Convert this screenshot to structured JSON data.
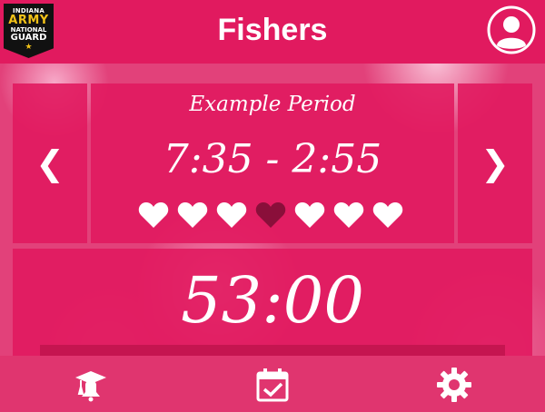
{
  "header": {
    "title": "Fishers",
    "badge": {
      "line1": "INDIANA",
      "line2": "ARMY",
      "line3": "NATIONAL",
      "line4": "GUARD",
      "star": "★"
    },
    "profile_icon": "user-avatar-icon"
  },
  "schedule": {
    "prev_label": "❮",
    "next_label": "❯",
    "period_name": "Example Period",
    "period_time": "7:35 - 2:55",
    "indicators": [
      false,
      false,
      false,
      true,
      false,
      false,
      false
    ]
  },
  "timer": {
    "countdown": "53:00",
    "progress_fraction": 0.0
  },
  "bottom_nav": {
    "tabs": [
      {
        "id": "graduation",
        "icon": "graduation-cap-bell-icon"
      },
      {
        "id": "calendar",
        "icon": "calendar-check-icon"
      },
      {
        "id": "settings",
        "icon": "gear-icon"
      }
    ]
  },
  "colors": {
    "primary": "#e11a5f",
    "indicator_active": "#8a0f3a",
    "indicator_inactive": "#ffffff",
    "nav_bar": "#e0356f"
  }
}
